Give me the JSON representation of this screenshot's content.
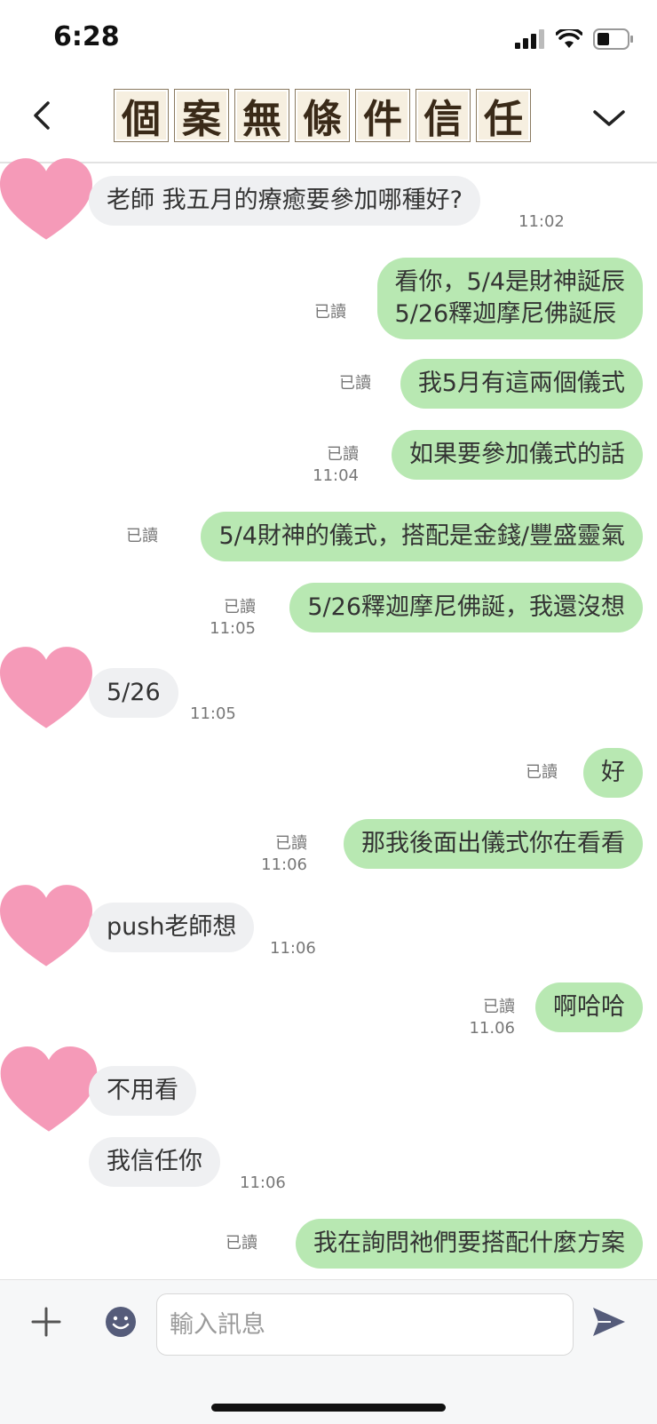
{
  "status_bar": {
    "time": "6:28"
  },
  "header": {
    "title_chars": [
      "個",
      "案",
      "無",
      "條",
      "件",
      "信",
      "任"
    ]
  },
  "messages": {
    "m1": {
      "text": "老師 我五月的療癒要參加哪種好?",
      "time": "11:02"
    },
    "m2": {
      "line1": "看你，5/4是財神誕辰",
      "line2": "5/26釋迦摩尼佛誕辰",
      "read": "已讀"
    },
    "m3": {
      "text": "我5月有這兩個儀式",
      "read": "已讀"
    },
    "m4": {
      "text": "如果要參加儀式的話",
      "read": "已讀",
      "time": "11:04"
    },
    "m5": {
      "text": "5/4財神的儀式，搭配是金錢/豐盛靈氣",
      "read": "已讀"
    },
    "m6": {
      "text": "5/26釋迦摩尼佛誕，我還沒想",
      "read": "已讀",
      "time": "11:05"
    },
    "m7": {
      "text": "5/26",
      "time": "11:05"
    },
    "m8": {
      "text": "好",
      "read": "已讀"
    },
    "m9": {
      "text": "那我後面出儀式你在看看",
      "read": "已讀",
      "time": "11:06"
    },
    "m10": {
      "text": "push老師想",
      "time": "11:06"
    },
    "m11": {
      "text": "啊哈哈",
      "read": "已讀",
      "time": "11.06"
    },
    "m12": {
      "text": "不用看"
    },
    "m13": {
      "text": "我信任你",
      "time": "11:06"
    },
    "m14": {
      "text": "我在詢問祂們要搭配什麼方案",
      "read": "已讀"
    }
  },
  "input": {
    "placeholder": "輸入訊息"
  },
  "colors": {
    "incoming": "#eff0f2",
    "outgoing": "#b8e8b2",
    "heart": "#f59ab8"
  },
  "icons": [
    "back-icon",
    "chevron-down-icon",
    "plus-icon",
    "emoji-icon",
    "send-icon",
    "signal-icon",
    "wifi-icon",
    "battery-icon",
    "heart-avatar-icon"
  ]
}
